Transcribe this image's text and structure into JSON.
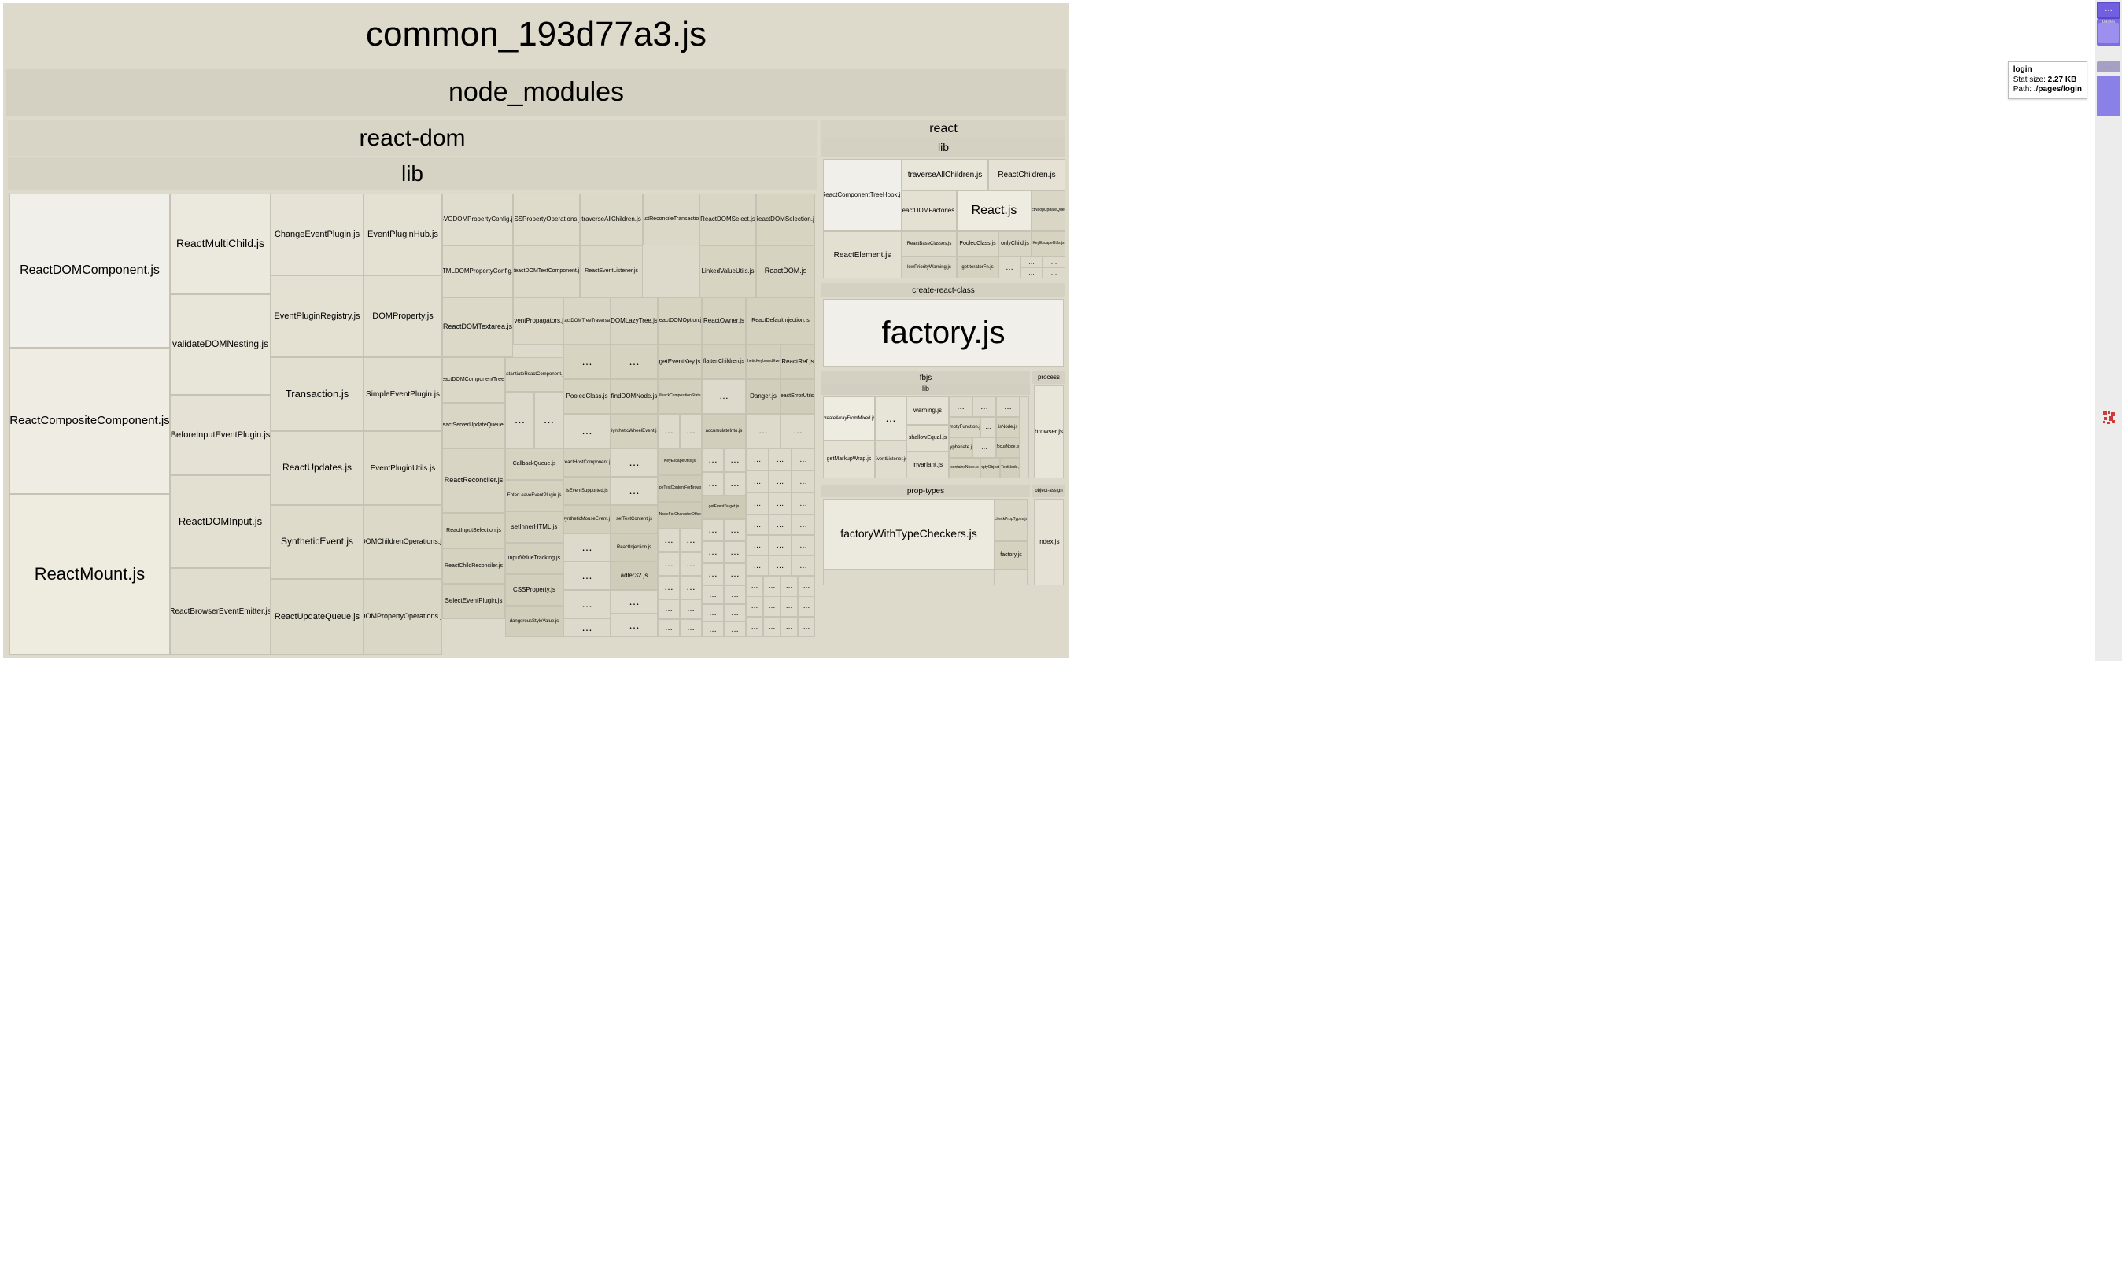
{
  "root_title": "common_193d77a3.js",
  "node_modules": "node_modules",
  "react_dom": "react-dom",
  "lib": "lib",
  "react": "react",
  "react_lib": "lib",
  "crc": "create-react-class",
  "factory": "factory.js",
  "fbjs": "fbjs",
  "fbjs_lib": "lib",
  "proptypes": "prop-types",
  "process": "process",
  "object_assign": "object-assign",
  "index_js": "index.js",
  "browser_js": "browser.js",
  "rd": {
    "ReactDOMComponent": "ReactDOMComponent.js",
    "ReactCompositeComponent": "ReactCompositeComponent.js",
    "ReactMount": "ReactMount.js",
    "ReactMultiChild": "ReactMultiChild.js",
    "validateDOMNesting": "validateDOMNesting.js",
    "BeforeInputEventPlugin": "BeforeInputEventPlugin.js",
    "ReactDOMInput": "ReactDOMInput.js",
    "ReactBrowserEventEmitter": "ReactBrowserEventEmitter.js",
    "ChangeEventPlugin": "ChangeEventPlugin.js",
    "EventPluginRegistry": "EventPluginRegistry.js",
    "Transaction": "Transaction.js",
    "ReactUpdates": "ReactUpdates.js",
    "SyntheticEvent": "SyntheticEvent.js",
    "ReactUpdateQueue": "ReactUpdateQueue.js",
    "EventPluginHub": "EventPluginHub.js",
    "DOMProperty": "DOMProperty.js",
    "SimpleEventPlugin": "SimpleEventPlugin.js",
    "EventPluginUtils": "EventPluginUtils.js",
    "DOMChildrenOperations": "DOMChildrenOperations.js",
    "DOMPropertyOperations": "DOMPropertyOperations.js",
    "SVGDOMPropertyConfig": "SVGDOMPropertyConfig.js",
    "HTMLDOMPropertyConfig": "HTMLDOMPropertyConfig.js",
    "ReactDOMTextarea": "ReactDOMTextarea.js",
    "ReactDOMComponentTree": "ReactDOMComponentTree.js",
    "ReactServerUpdateQueue": "ReactServerUpdateQueue.js",
    "ReactReconciler": "ReactReconciler.js",
    "ReactInputSelection": "ReactInputSelection.js",
    "ReactChildReconciler": "ReactChildReconciler.js",
    "SelectEventPlugin": "SelectEventPlugin.js",
    "CSSPropertyOperations": "CSSPropertyOperations.js",
    "ReactDOMTextComponent": "ReactDOMTextComponent.js",
    "EventPropagators": "EventPropagators.js",
    "instantiateReactComponent": "instantiateReactComponent.js",
    "setInnerHTML": "setInnerHTML.js",
    "CSSProperty": "CSSProperty.js",
    "traverseAllChildren": "traverseAllChildren.js",
    "ReactEventListener": "ReactEventListener.js",
    "ReactDOMTreeTraversal": "ReactDOMTreeTraversal.js",
    "PooledClass": "PooledClass.js",
    "CallbackQueue": "CallbackQueue.js",
    "EnterLeaveEventPlugin": "EnterLeaveEventPlugin.js",
    "inputValueTracking": "inputValueTracking.js",
    "dangerousStyleValue": "dangerousStyleValue.js",
    "ReactDOMSelect": "ReactDOMSelect.js",
    "ReactReconcileTransaction": "ReactReconcileTransaction.js",
    "DOMLazyTree": "DOMLazyTree.js",
    "findDOMNode": "findDOMNode.js",
    "ReactHostComponent": "ReactHostComponent.js",
    "isEventSupported": "isEventSupported.js",
    "SyntheticMouseEvent": "SyntheticMouseEvent.js",
    "setTextContent": "setTextContent.js",
    "ReactInjection": "ReactInjection.js",
    "adler32": "adler32.js",
    "ReactDOMSelection": "ReactDOMSelection.js",
    "LinkedValueUtils": "LinkedValueUtils.js",
    "ReactDOMOption": "ReactDOMOption.js",
    "FallbackCompositionState": "FallbackCompositionState.js",
    "getEventKey": "getEventKey.js",
    "ReactDOM": "ReactDOM.js",
    "ReactOwner": "ReactOwner.js",
    "flattenChildren": "flattenChildren.js",
    "SyntheticKeyboardEvent": "SyntheticKeyboardEvent.js",
    "Danger": "Danger.js",
    "ReactRef": "ReactRef.js",
    "ReactErrorUtils": "ReactErrorUtils.js",
    "ReactDefaultInjection": "ReactDefaultInjection.js",
    "SyntheticWheelEvent": "SyntheticWheelEvent.js",
    "accumulateInto": "accumulateInto.js",
    "KeyEscapeUtils": "KeyEscapeUtils.js",
    "getNodeForCharacterOffset": "getNodeForCharacterOffset.js",
    "getEventTarget": "getEventTarget.js",
    "escapeTextContentForBrowser": "escapeTextContentForBrowser.js"
  },
  "r": {
    "ReactComponentTreeHook": "ReactComponentTreeHook.js",
    "traverseAllChildren": "traverseAllChildren.js",
    "ReactChildren": "ReactChildren.js",
    "ReactElement": "ReactElement.js",
    "ReactDOMFactories": "ReactDOMFactories.js",
    "React": "React.js",
    "ReactBaseClasses": "ReactBaseClasses.js",
    "ReactNoopUpdateQueue": "ReactNoopUpdateQueue.js",
    "PooledClass": "PooledClass.js",
    "onlyChild": "onlyChild.js",
    "KeyEscapeUtils": "KeyEscapeUtils.js",
    "lowPriorityWarning": "lowPriorityWarning.js",
    "getIteratorFn": "getIteratorFn.js"
  },
  "pt": {
    "factoryWithTypeCheckers": "factoryWithTypeCheckers.js",
    "checkPropTypes": "checkPropTypes.js",
    "factory": "factory.js"
  },
  "fb": {
    "createArrayFromMixed": "createArrayFromMixed.js",
    "getMarkupWrap": "getMarkupWrap.js",
    "warning": "warning.js",
    "shallowEqual": "shallowEqual.js",
    "invariant": "invariant.js",
    "EventListener": "EventListener.js",
    "emptyFunction": "emptyFunction.js",
    "containsNode": "containsNode.js",
    "emptyObject": "emptyObject.js",
    "focusNode": "focusNode.js",
    "isNode": "isNode.js",
    "hyphenate": "hyphenate.js",
    "isTextNode": "isTextNode.js"
  },
  "tooltip": {
    "title": "login",
    "stat_label": "Stat size:",
    "stat_value": "2.27 KB",
    "path_label": "Path:",
    "path_value": "./pages/login"
  },
  "mini": {
    "main_label": "…",
    "pages": "pages",
    "mid_label": "…"
  },
  "ellipsis": "…"
}
